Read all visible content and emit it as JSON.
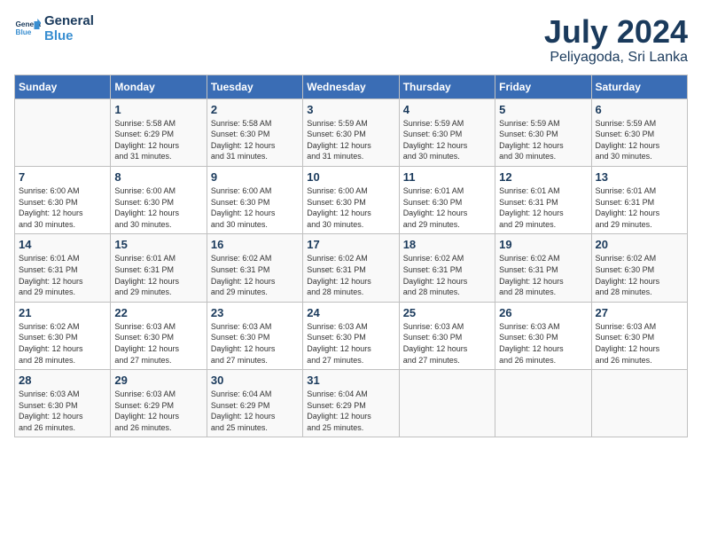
{
  "header": {
    "logo_line1": "General",
    "logo_line2": "Blue",
    "month_year": "July 2024",
    "location": "Peliyagoda, Sri Lanka"
  },
  "days_of_week": [
    "Sunday",
    "Monday",
    "Tuesday",
    "Wednesday",
    "Thursday",
    "Friday",
    "Saturday"
  ],
  "weeks": [
    [
      {
        "day": "",
        "info": ""
      },
      {
        "day": "1",
        "info": "Sunrise: 5:58 AM\nSunset: 6:29 PM\nDaylight: 12 hours\nand 31 minutes."
      },
      {
        "day": "2",
        "info": "Sunrise: 5:58 AM\nSunset: 6:30 PM\nDaylight: 12 hours\nand 31 minutes."
      },
      {
        "day": "3",
        "info": "Sunrise: 5:59 AM\nSunset: 6:30 PM\nDaylight: 12 hours\nand 31 minutes."
      },
      {
        "day": "4",
        "info": "Sunrise: 5:59 AM\nSunset: 6:30 PM\nDaylight: 12 hours\nand 30 minutes."
      },
      {
        "day": "5",
        "info": "Sunrise: 5:59 AM\nSunset: 6:30 PM\nDaylight: 12 hours\nand 30 minutes."
      },
      {
        "day": "6",
        "info": "Sunrise: 5:59 AM\nSunset: 6:30 PM\nDaylight: 12 hours\nand 30 minutes."
      }
    ],
    [
      {
        "day": "7",
        "info": "Sunrise: 6:00 AM\nSunset: 6:30 PM\nDaylight: 12 hours\nand 30 minutes."
      },
      {
        "day": "8",
        "info": "Sunrise: 6:00 AM\nSunset: 6:30 PM\nDaylight: 12 hours\nand 30 minutes."
      },
      {
        "day": "9",
        "info": "Sunrise: 6:00 AM\nSunset: 6:30 PM\nDaylight: 12 hours\nand 30 minutes."
      },
      {
        "day": "10",
        "info": "Sunrise: 6:00 AM\nSunset: 6:30 PM\nDaylight: 12 hours\nand 30 minutes."
      },
      {
        "day": "11",
        "info": "Sunrise: 6:01 AM\nSunset: 6:30 PM\nDaylight: 12 hours\nand 29 minutes."
      },
      {
        "day": "12",
        "info": "Sunrise: 6:01 AM\nSunset: 6:31 PM\nDaylight: 12 hours\nand 29 minutes."
      },
      {
        "day": "13",
        "info": "Sunrise: 6:01 AM\nSunset: 6:31 PM\nDaylight: 12 hours\nand 29 minutes."
      }
    ],
    [
      {
        "day": "14",
        "info": "Sunrise: 6:01 AM\nSunset: 6:31 PM\nDaylight: 12 hours\nand 29 minutes."
      },
      {
        "day": "15",
        "info": "Sunrise: 6:01 AM\nSunset: 6:31 PM\nDaylight: 12 hours\nand 29 minutes."
      },
      {
        "day": "16",
        "info": "Sunrise: 6:02 AM\nSunset: 6:31 PM\nDaylight: 12 hours\nand 29 minutes."
      },
      {
        "day": "17",
        "info": "Sunrise: 6:02 AM\nSunset: 6:31 PM\nDaylight: 12 hours\nand 28 minutes."
      },
      {
        "day": "18",
        "info": "Sunrise: 6:02 AM\nSunset: 6:31 PM\nDaylight: 12 hours\nand 28 minutes."
      },
      {
        "day": "19",
        "info": "Sunrise: 6:02 AM\nSunset: 6:31 PM\nDaylight: 12 hours\nand 28 minutes."
      },
      {
        "day": "20",
        "info": "Sunrise: 6:02 AM\nSunset: 6:30 PM\nDaylight: 12 hours\nand 28 minutes."
      }
    ],
    [
      {
        "day": "21",
        "info": "Sunrise: 6:02 AM\nSunset: 6:30 PM\nDaylight: 12 hours\nand 28 minutes."
      },
      {
        "day": "22",
        "info": "Sunrise: 6:03 AM\nSunset: 6:30 PM\nDaylight: 12 hours\nand 27 minutes."
      },
      {
        "day": "23",
        "info": "Sunrise: 6:03 AM\nSunset: 6:30 PM\nDaylight: 12 hours\nand 27 minutes."
      },
      {
        "day": "24",
        "info": "Sunrise: 6:03 AM\nSunset: 6:30 PM\nDaylight: 12 hours\nand 27 minutes."
      },
      {
        "day": "25",
        "info": "Sunrise: 6:03 AM\nSunset: 6:30 PM\nDaylight: 12 hours\nand 27 minutes."
      },
      {
        "day": "26",
        "info": "Sunrise: 6:03 AM\nSunset: 6:30 PM\nDaylight: 12 hours\nand 26 minutes."
      },
      {
        "day": "27",
        "info": "Sunrise: 6:03 AM\nSunset: 6:30 PM\nDaylight: 12 hours\nand 26 minutes."
      }
    ],
    [
      {
        "day": "28",
        "info": "Sunrise: 6:03 AM\nSunset: 6:30 PM\nDaylight: 12 hours\nand 26 minutes."
      },
      {
        "day": "29",
        "info": "Sunrise: 6:03 AM\nSunset: 6:29 PM\nDaylight: 12 hours\nand 26 minutes."
      },
      {
        "day": "30",
        "info": "Sunrise: 6:04 AM\nSunset: 6:29 PM\nDaylight: 12 hours\nand 25 minutes."
      },
      {
        "day": "31",
        "info": "Sunrise: 6:04 AM\nSunset: 6:29 PM\nDaylight: 12 hours\nand 25 minutes."
      },
      {
        "day": "",
        "info": ""
      },
      {
        "day": "",
        "info": ""
      },
      {
        "day": "",
        "info": ""
      }
    ]
  ]
}
